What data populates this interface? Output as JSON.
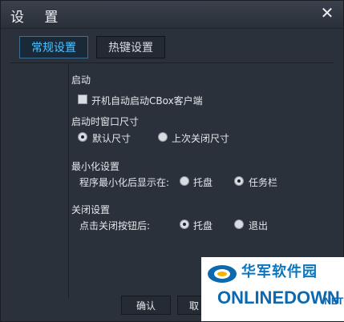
{
  "window": {
    "title": "设 置",
    "close_glyph": "✕"
  },
  "tabs": [
    {
      "label": "常规设置",
      "active": true
    },
    {
      "label": "热键设置",
      "active": false
    }
  ],
  "startup": {
    "section_title": "启动",
    "auto_start_label": "开机自动启动CBox客户端",
    "auto_start_checked": false
  },
  "window_size": {
    "section_title": "启动时窗口尺寸",
    "options": [
      {
        "label": "默认尺寸",
        "checked": true
      },
      {
        "label": "上次关闭尺寸",
        "checked": false
      }
    ]
  },
  "minimize": {
    "section_title": "最小化设置",
    "prompt": "程序最小化后显示在:",
    "options": [
      {
        "label": "托盘",
        "checked": false
      },
      {
        "label": "任务栏",
        "checked": true
      }
    ]
  },
  "close": {
    "section_title": "关闭设置",
    "prompt": "点击关闭按钮后:",
    "options": [
      {
        "label": "托盘",
        "checked": true
      },
      {
        "label": "退出",
        "checked": false
      }
    ]
  },
  "buttons": {
    "confirm": "确认",
    "cancel": "取"
  },
  "watermark": {
    "line1": "华军软件园",
    "line2": "ONLINEDOWN",
    "suffix": ".NET"
  },
  "colors": {
    "accent": "#4fc3ff",
    "background": "#2b313a"
  }
}
